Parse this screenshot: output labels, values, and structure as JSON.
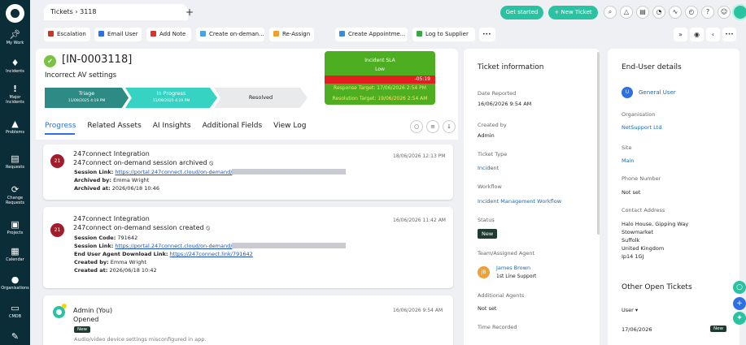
{
  "sidebar": {
    "items": [
      {
        "label": "My Work",
        "icon": "pin-icon"
      },
      {
        "label": "Incidents",
        "icon": "incidents-icon"
      },
      {
        "label": "Major Incidents",
        "icon": "exclamation-icon"
      },
      {
        "label": "Problems",
        "icon": "warning-icon"
      },
      {
        "label": "Requests",
        "icon": "cart-icon"
      },
      {
        "label": "Change Requests",
        "icon": "refresh-icon"
      },
      {
        "label": "Projects",
        "icon": "briefcase-icon"
      },
      {
        "label": "Calendar",
        "icon": "calendar-icon"
      },
      {
        "label": "Organisations",
        "icon": "person-icon"
      },
      {
        "label": "CMDB",
        "icon": "monitor-icon"
      },
      {
        "label": "",
        "icon": "edit-icon"
      }
    ]
  },
  "topbar": {
    "breadcrumb": "Tickets  ›  3118",
    "new_tab": "+",
    "get_started": "Get started",
    "new_ticket": "+ New Ticket"
  },
  "actions": [
    {
      "label": "Escalation",
      "color": "#c0392b",
      "icon": "escalation-icon"
    },
    {
      "label": "Email User",
      "color": "#2d6fe4",
      "icon": "email-icon"
    },
    {
      "label": "Add Note",
      "color": "#d9342b",
      "icon": "note-icon"
    },
    {
      "label": "Create on-deman...",
      "color": "#4aa3df",
      "icon": "link-icon"
    },
    {
      "label": "Re-Assign",
      "color": "#f0a030",
      "icon": "reassign-icon"
    },
    {
      "label": "Create Appointme...",
      "color": "#3b8bd6",
      "icon": "calendar-icon"
    },
    {
      "label": "Log to Supplier",
      "color": "#3aa64a",
      "icon": "supplier-icon"
    }
  ],
  "more": "•••",
  "ticket": {
    "id": "[IN-0003118]",
    "subject": "Incorrect AV settings",
    "stages": [
      {
        "label": "Triage",
        "date": "11/09/2025 4:19 PM",
        "color": "#2e8a85"
      },
      {
        "label": "In Progress",
        "date": "11/09/2025 4:19 PM",
        "color": "#36d3c3"
      },
      {
        "label": "Resolved",
        "date": "",
        "color": "#e9eaec"
      }
    ],
    "sla": {
      "title": "Incident SLA",
      "priority": "Low",
      "countdown": "-05:19",
      "response": "Response Target: 17/06/2026 2:54 PM",
      "resolution": "Resolution Target: 19/06/2026 2:54 AM"
    }
  },
  "tabs": [
    "Progress",
    "Related Assets",
    "AI Insights",
    "Additional Fields",
    "View Log"
  ],
  "feed": [
    {
      "avatar": "21",
      "author": "247connect Integration",
      "action": "247connect on-demand session archived",
      "date": "18/06/2026 12:13 PM",
      "lines": [
        {
          "label": "Session Link:",
          "value": "https://portal.247connect.cloud/on-demand/",
          "link": true,
          "redacted": true
        },
        {
          "label": "Archived by:",
          "value": "Emma Wright"
        },
        {
          "label": "Archived at:",
          "value": "2026/06/18 10:46"
        }
      ]
    },
    {
      "avatar": "21",
      "author": "247connect Integration",
      "action": "247connect on-demand session created",
      "date": "16/06/2026 11:42 AM",
      "lines": [
        {
          "label": "Session Code:",
          "value": "791642"
        },
        {
          "label": "Session Link:",
          "value": "https://portal.247connect.cloud/on-demand/",
          "link": true,
          "redacted": true
        },
        {
          "label": "End User Agent Download Link:",
          "value": "https://247connect.link/791642",
          "link": true
        },
        {
          "label": "Created by:",
          "value": "Emma Wright"
        },
        {
          "label": "Created at:",
          "value": "2026/06/18 10:42"
        }
      ]
    },
    {
      "author": "Admin (You)",
      "action": "Opened",
      "date": "16/06/2026 9:54 AM",
      "status": "New",
      "note": "Audio/video device settings misconfigured in app."
    }
  ],
  "ticket_info": {
    "title": "Ticket information",
    "fields": [
      {
        "label": "Date Reported",
        "value": "16/06/2026 9:54 AM"
      },
      {
        "label": "Created by",
        "value": "Admin"
      },
      {
        "label": "Ticket Type",
        "value": "Incident",
        "link": true
      },
      {
        "label": "Workflow",
        "value": "Incident Management Workflow",
        "link": true
      },
      {
        "label": "Status",
        "value": "New",
        "pill": true
      },
      {
        "label": "Team/Assigned Agent",
        "agent": "James Brown",
        "team": "1st Line Support",
        "initials": "JB"
      },
      {
        "label": "Additional Agents",
        "value": "Not set"
      },
      {
        "label": "Time Recorded",
        "value": ""
      }
    ]
  },
  "end_user": {
    "title": "End-User details",
    "user": "General User",
    "user_initial": "U",
    "fields": [
      {
        "label": "Organisation",
        "value": "NetSupport Ltd",
        "link": true
      },
      {
        "label": "Site",
        "value": "Main",
        "link": true
      },
      {
        "label": "Phone Number",
        "value": "Not set"
      },
      {
        "label": "Contact Address",
        "value": "Halo House, Gipping Way\nStowmarket\nSuffolk\nUnited Kingdom\nIp14 1GJ"
      }
    ],
    "other_title": "Other Open Tickets",
    "filter": "User ▾",
    "other_date": "17/06/2026",
    "other_status": "New"
  }
}
